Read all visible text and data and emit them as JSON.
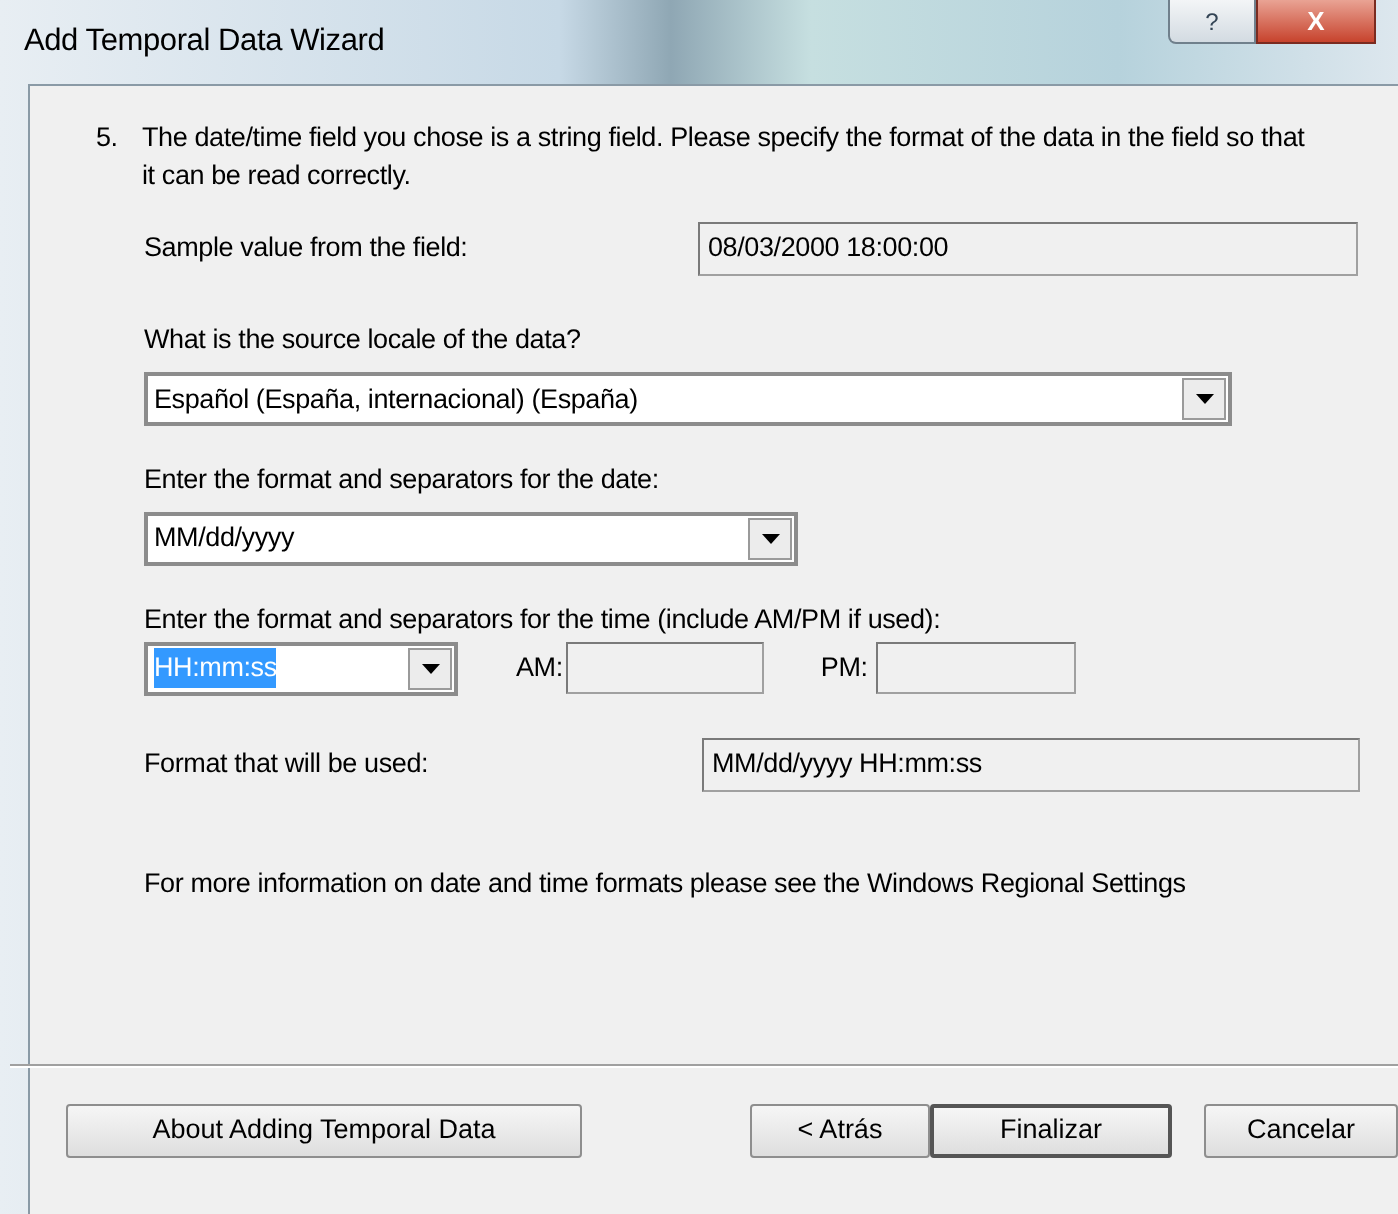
{
  "window": {
    "title": "Add Temporal Data Wizard",
    "controls": [
      {
        "kind": "help",
        "label": "?"
      },
      {
        "kind": "close",
        "label": "X"
      }
    ]
  },
  "step": {
    "number": "5.",
    "text": "The date/time field you chose is a string field.  Please specify the format of the data in the field so that it can be read correctly."
  },
  "sample": {
    "label": "Sample value from the field:",
    "value": "08/03/2000 18:00:00"
  },
  "locale": {
    "label": "What is the source locale of the data?",
    "value": "Español (España, internacional) (España)"
  },
  "date_format": {
    "label": "Enter the format and separators for the date:",
    "value": "MM/dd/yyyy"
  },
  "time_format": {
    "label": "Enter the format and separators for the time (include AM/PM if used):",
    "value": "HH:mm:ss",
    "text_selected": true
  },
  "am": {
    "label": "AM:"
  },
  "pm": {
    "label": "PM:"
  },
  "format_used": {
    "label": "Format that will be used:",
    "value": "MM/dd/yyyy HH:mm:ss"
  },
  "info": "For more information on date and time formats please see the Windows Regional Settings",
  "buttons": [
    {
      "label": "About Adding Temporal Data",
      "default": false
    },
    {
      "label": "< Atrás",
      "default": false
    },
    {
      "label": "Finalizar",
      "default": true
    },
    {
      "label": "Cancelar",
      "default": false
    }
  ]
}
